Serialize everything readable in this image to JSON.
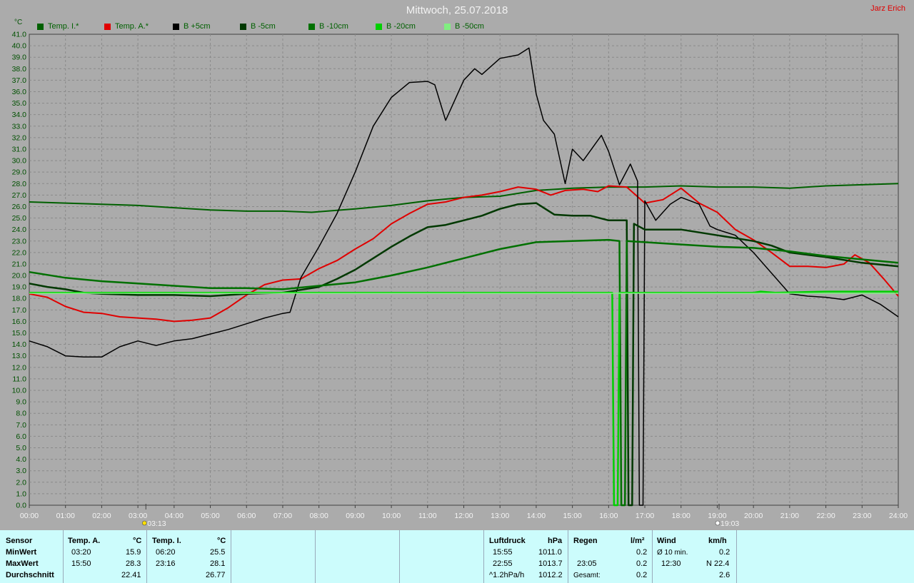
{
  "title": "Mittwoch, 25.07.2018",
  "author": "Jarz Erich",
  "y_unit": "°C",
  "legend": [
    {
      "label": "Temp. I.*",
      "color": "#006000"
    },
    {
      "label": "Temp. A.*",
      "color": "#e00000"
    },
    {
      "label": "B +5cm",
      "color": "#000000"
    },
    {
      "label": "B -5cm",
      "color": "#003800"
    },
    {
      "label": "B -10cm",
      "color": "#007000"
    },
    {
      "label": "B -20cm",
      "color": "#00d000"
    },
    {
      "label": "B -50cm",
      "color": "#80ee80"
    }
  ],
  "chart_data": {
    "type": "line",
    "xlim": [
      0,
      24
    ],
    "ylim": [
      0,
      41
    ],
    "x_tick_labels": [
      "00:00",
      "01:00",
      "02:00",
      "03:00",
      "04:00",
      "05:00",
      "06:00",
      "07:00",
      "08:00",
      "09:00",
      "10:00",
      "11:00",
      "12:00",
      "13:00",
      "14:00",
      "15:00",
      "16:00",
      "17:00",
      "18:00",
      "19:00",
      "20:00",
      "21:00",
      "22:00",
      "23:00",
      "24:00"
    ],
    "y_tick_labels": [
      "0.0",
      "1.0",
      "2.0",
      "3.0",
      "4.0",
      "5.0",
      "6.0",
      "7.0",
      "8.0",
      "9.0",
      "10.0",
      "11.0",
      "12.0",
      "13.0",
      "14.0",
      "15.0",
      "16.0",
      "17.0",
      "18.0",
      "19.0",
      "20.0",
      "21.0",
      "22.0",
      "23.0",
      "24.0",
      "25.0",
      "26.0",
      "27.0",
      "28.0",
      "29.0",
      "30.0",
      "31.0",
      "32.0",
      "33.0",
      "34.0",
      "35.0",
      "36.0",
      "37.0",
      "38.0",
      "39.0",
      "40.0",
      "41.0"
    ],
    "grid": true,
    "markers": [
      {
        "label": "03:13",
        "x": 3.22,
        "icon": "sunrise-icon"
      },
      {
        "label": "19:03",
        "x": 19.05,
        "icon": "sunset-icon"
      }
    ],
    "series": [
      {
        "name": "Temp. I.*",
        "color": "#006000",
        "width": 2,
        "points": [
          [
            0,
            26.4
          ],
          [
            1,
            26.3
          ],
          [
            2,
            26.2
          ],
          [
            3,
            26.1
          ],
          [
            4,
            25.9
          ],
          [
            5,
            25.7
          ],
          [
            6,
            25.6
          ],
          [
            7,
            25.6
          ],
          [
            7.8,
            25.5
          ],
          [
            9,
            25.8
          ],
          [
            10,
            26.1
          ],
          [
            11,
            26.5
          ],
          [
            12,
            26.8
          ],
          [
            13,
            26.9
          ],
          [
            14,
            27.4
          ],
          [
            15,
            27.6
          ],
          [
            16,
            27.7
          ],
          [
            17,
            27.7
          ],
          [
            18,
            27.8
          ],
          [
            19,
            27.7
          ],
          [
            20,
            27.7
          ],
          [
            21,
            27.6
          ],
          [
            22,
            27.8
          ],
          [
            23,
            27.9
          ],
          [
            24,
            28.0
          ]
        ]
      },
      {
        "name": "Temp. A.*",
        "color": "#e00000",
        "width": 2,
        "points": [
          [
            0,
            18.4
          ],
          [
            0.5,
            18.1
          ],
          [
            1,
            17.3
          ],
          [
            1.5,
            16.8
          ],
          [
            2,
            16.7
          ],
          [
            2.5,
            16.4
          ],
          [
            3,
            16.3
          ],
          [
            3.5,
            16.2
          ],
          [
            4,
            16.0
          ],
          [
            4.5,
            16.1
          ],
          [
            5,
            16.3
          ],
          [
            5.5,
            17.2
          ],
          [
            6,
            18.3
          ],
          [
            6.5,
            19.2
          ],
          [
            7,
            19.6
          ],
          [
            7.5,
            19.7
          ],
          [
            8,
            20.6
          ],
          [
            8.5,
            21.3
          ],
          [
            9,
            22.3
          ],
          [
            9.5,
            23.2
          ],
          [
            10,
            24.5
          ],
          [
            10.5,
            25.4
          ],
          [
            11,
            26.2
          ],
          [
            11.5,
            26.4
          ],
          [
            12,
            26.8
          ],
          [
            12.5,
            27.0
          ],
          [
            13,
            27.3
          ],
          [
            13.5,
            27.7
          ],
          [
            14,
            27.5
          ],
          [
            14.4,
            27.0
          ],
          [
            14.8,
            27.4
          ],
          [
            15.3,
            27.5
          ],
          [
            15.7,
            27.3
          ],
          [
            16,
            27.8
          ],
          [
            16.5,
            27.7
          ],
          [
            17,
            26.3
          ],
          [
            17.5,
            26.6
          ],
          [
            18,
            27.6
          ],
          [
            18.5,
            26.3
          ],
          [
            19,
            25.5
          ],
          [
            19.5,
            24.0
          ],
          [
            20,
            23.1
          ],
          [
            20.5,
            22.0
          ],
          [
            21,
            20.8
          ],
          [
            21.5,
            20.8
          ],
          [
            22,
            20.7
          ],
          [
            22.5,
            21.0
          ],
          [
            22.8,
            21.8
          ],
          [
            23.2,
            21.1
          ],
          [
            23.6,
            19.7
          ],
          [
            24,
            18.2
          ]
        ]
      },
      {
        "name": "B +5cm",
        "color": "#000000",
        "width": 1.5,
        "points": [
          [
            0,
            14.3
          ],
          [
            0.5,
            13.8
          ],
          [
            1,
            13.0
          ],
          [
            1.5,
            12.9
          ],
          [
            2,
            12.9
          ],
          [
            2.5,
            13.8
          ],
          [
            3,
            14.3
          ],
          [
            3.5,
            13.9
          ],
          [
            4,
            14.3
          ],
          [
            4.5,
            14.5
          ],
          [
            5,
            14.9
          ],
          [
            5.5,
            15.3
          ],
          [
            6,
            15.8
          ],
          [
            6.5,
            16.3
          ],
          [
            7,
            16.7
          ],
          [
            7.2,
            16.8
          ],
          [
            7.5,
            19.8
          ],
          [
            8,
            22.5
          ],
          [
            8.5,
            25.4
          ],
          [
            9,
            29.0
          ],
          [
            9.5,
            33.0
          ],
          [
            10,
            35.5
          ],
          [
            10.5,
            36.8
          ],
          [
            11,
            36.9
          ],
          [
            11.2,
            36.6
          ],
          [
            11.5,
            33.5
          ],
          [
            12,
            37.0
          ],
          [
            12.3,
            38.0
          ],
          [
            12.5,
            37.5
          ],
          [
            13,
            38.9
          ],
          [
            13.5,
            39.2
          ],
          [
            13.8,
            39.8
          ],
          [
            14,
            35.8
          ],
          [
            14.2,
            33.5
          ],
          [
            14.5,
            32.3
          ],
          [
            14.8,
            28.0
          ],
          [
            15,
            31.0
          ],
          [
            15.3,
            30.0
          ],
          [
            15.8,
            32.2
          ],
          [
            16,
            30.8
          ],
          [
            16.3,
            27.9
          ],
          [
            16.6,
            29.7
          ],
          [
            16.8,
            28.2
          ],
          [
            16.85,
            0
          ],
          [
            16.95,
            0
          ],
          [
            17.0,
            26.5
          ],
          [
            17.3,
            24.8
          ],
          [
            17.7,
            26.2
          ],
          [
            18,
            26.8
          ],
          [
            18.5,
            26.2
          ],
          [
            18.8,
            24.3
          ],
          [
            19,
            24.0
          ],
          [
            19.5,
            23.5
          ],
          [
            20,
            22.0
          ],
          [
            20.5,
            20.2
          ],
          [
            21,
            18.4
          ],
          [
            21.5,
            18.2
          ],
          [
            22,
            18.1
          ],
          [
            22.5,
            17.9
          ],
          [
            23,
            18.3
          ],
          [
            23.5,
            17.5
          ],
          [
            24,
            16.4
          ]
        ]
      },
      {
        "name": "B -5cm",
        "color": "#003800",
        "width": 2.5,
        "points": [
          [
            0,
            19.3
          ],
          [
            0.5,
            19.0
          ],
          [
            1,
            18.8
          ],
          [
            1.5,
            18.5
          ],
          [
            2,
            18.4
          ],
          [
            3,
            18.3
          ],
          [
            4,
            18.3
          ],
          [
            5,
            18.2
          ],
          [
            6,
            18.4
          ],
          [
            7,
            18.5
          ],
          [
            8,
            19.0
          ],
          [
            8.5,
            19.7
          ],
          [
            9,
            20.5
          ],
          [
            9.5,
            21.5
          ],
          [
            10,
            22.5
          ],
          [
            10.5,
            23.4
          ],
          [
            11,
            24.2
          ],
          [
            11.5,
            24.4
          ],
          [
            12,
            24.8
          ],
          [
            12.5,
            25.2
          ],
          [
            13,
            25.8
          ],
          [
            13.5,
            26.2
          ],
          [
            14,
            26.3
          ],
          [
            14.5,
            25.3
          ],
          [
            15,
            25.2
          ],
          [
            15.5,
            25.2
          ],
          [
            16,
            24.8
          ],
          [
            16.5,
            24.8
          ],
          [
            16.55,
            0
          ],
          [
            16.65,
            0
          ],
          [
            16.7,
            24.5
          ],
          [
            17,
            24.0
          ],
          [
            18,
            24.0
          ],
          [
            19,
            23.5
          ],
          [
            20,
            23.0
          ],
          [
            20.5,
            22.6
          ],
          [
            21,
            22.0
          ],
          [
            22,
            21.6
          ],
          [
            23,
            21.1
          ],
          [
            24,
            20.8
          ]
        ]
      },
      {
        "name": "B -10cm",
        "color": "#007000",
        "width": 2.5,
        "points": [
          [
            0,
            20.3
          ],
          [
            1,
            19.8
          ],
          [
            2,
            19.5
          ],
          [
            3,
            19.3
          ],
          [
            4,
            19.1
          ],
          [
            5,
            18.9
          ],
          [
            6,
            18.9
          ],
          [
            7,
            18.8
          ],
          [
            8,
            19.1
          ],
          [
            9,
            19.4
          ],
          [
            10,
            20.0
          ],
          [
            11,
            20.7
          ],
          [
            12,
            21.5
          ],
          [
            13,
            22.3
          ],
          [
            14,
            22.9
          ],
          [
            15,
            23.0
          ],
          [
            16,
            23.1
          ],
          [
            16.3,
            23.0
          ],
          [
            16.35,
            0
          ],
          [
            16.45,
            0
          ],
          [
            16.5,
            23.0
          ],
          [
            17,
            22.9
          ],
          [
            18,
            22.7
          ],
          [
            19,
            22.5
          ],
          [
            20,
            22.4
          ],
          [
            21,
            22.1
          ],
          [
            22,
            21.7
          ],
          [
            23,
            21.4
          ],
          [
            24,
            21.1
          ]
        ]
      },
      {
        "name": "B -20cm",
        "color": "#00d000",
        "width": 2.5,
        "points": [
          [
            0,
            18.5
          ],
          [
            6,
            18.5
          ],
          [
            12,
            18.5
          ],
          [
            16.1,
            18.5
          ],
          [
            16.15,
            0
          ],
          [
            16.25,
            0
          ],
          [
            16.3,
            18.5
          ],
          [
            18,
            18.5
          ],
          [
            20,
            18.5
          ],
          [
            20.2,
            18.6
          ],
          [
            20.6,
            18.5
          ],
          [
            22,
            18.6
          ],
          [
            24,
            18.6
          ]
        ]
      },
      {
        "name": "B -50cm",
        "color": "#80ee80",
        "width": 1.5,
        "points": [
          [
            0,
            18.45
          ],
          [
            24,
            18.45
          ]
        ]
      }
    ]
  },
  "stats": {
    "temp_a": {
      "header": "Temp. A.",
      "unit": "°C"
    },
    "temp_i": {
      "header": "Temp. I.",
      "unit": "°C"
    },
    "rows": {
      "sensor": "Sensor",
      "min": "MinWert",
      "max": "MaxWert",
      "avg": "Durchschnitt"
    },
    "temp_a_min_time": "03:20",
    "temp_a_min": "15.9",
    "temp_a_max_time": "15:50",
    "temp_a_max": "28.3",
    "temp_a_avg": "22.41",
    "temp_i_min_time": "06:20",
    "temp_i_min": "25.5",
    "temp_i_max_time": "23:16",
    "temp_i_max": "28.1",
    "temp_i_avg": "26.77",
    "pressure": {
      "header": "Luftdruck",
      "unit": "hPa",
      "min_time": "15:55",
      "min": "1011.0",
      "max_time": "22:55",
      "max": "1013.7",
      "trend_label": "^1.2hPa/h",
      "avg": "1012.2"
    },
    "rain": {
      "header": "Regen",
      "unit": "l/m²",
      "min": "0.2",
      "max_time": "23:05",
      "max": "0.2",
      "total_label": "Gesamt:",
      "total": "0.2"
    },
    "wind": {
      "header": "Wind",
      "unit": "km/h",
      "avg_label": "Ø 10 min.",
      "avg_val": "0.2",
      "max_time": "12:30",
      "max_val": "N 22.4",
      "mean": "2.6"
    }
  }
}
